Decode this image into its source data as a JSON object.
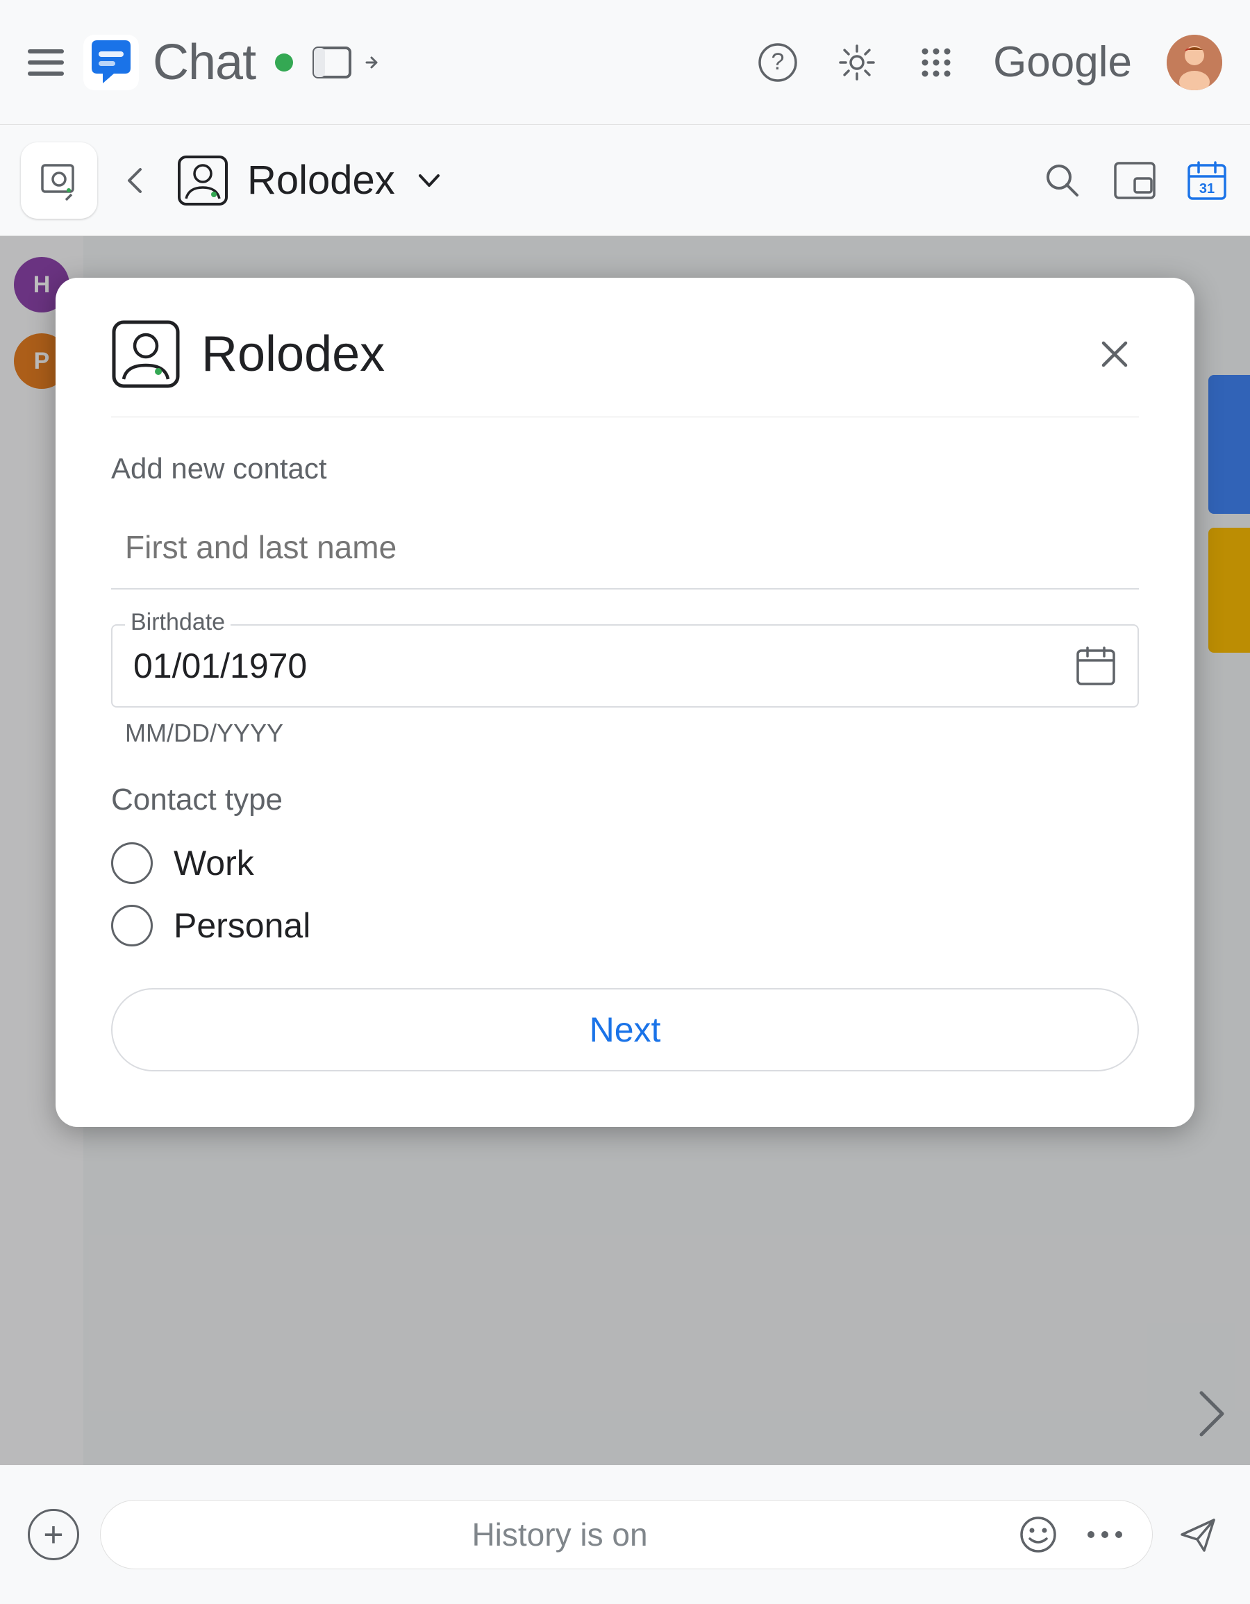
{
  "topbar": {
    "app_name": "Chat",
    "status": "online",
    "google_text": "Google"
  },
  "subbar": {
    "app_name": "Rolodex",
    "dropdown_char": "∨"
  },
  "modal": {
    "title": "Rolodex",
    "close_char": "✕",
    "section_add": "Add new contact",
    "name_placeholder": "First and last name",
    "birthdate_label": "Birthdate",
    "birthdate_value": "01/01/1970",
    "birthdate_format": "MM/DD/YYYY",
    "contact_type_label": "Contact type",
    "radio_work": "Work",
    "radio_personal": "Personal",
    "next_label": "Next"
  },
  "bottom": {
    "history_text": "History is on",
    "add_icon": "+",
    "more_icon": "···"
  },
  "sidebar": {
    "avatar1_letter": "H",
    "avatar1_color": "#8e44ad",
    "avatar2_letter": "P",
    "avatar2_color": "#e67e22"
  }
}
